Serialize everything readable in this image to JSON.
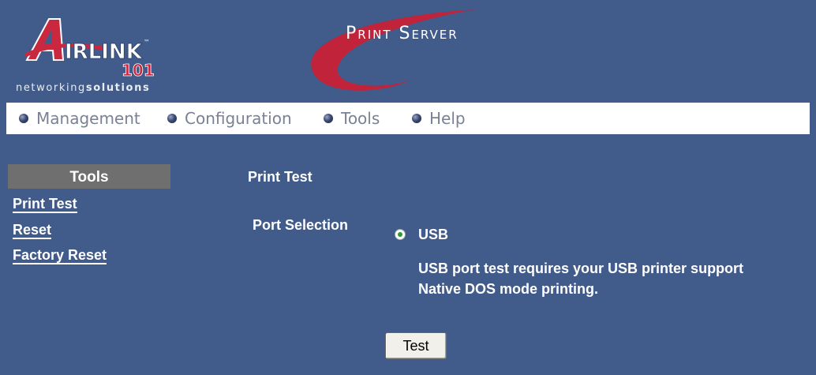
{
  "header": {
    "brand_logo_text": "AIRLINK 101",
    "tagline_light": "networking",
    "tagline_bold": "solutions",
    "product_title": "Print Server"
  },
  "nav": {
    "items": [
      {
        "label": "Management"
      },
      {
        "label": "Configuration"
      },
      {
        "label": "Tools"
      },
      {
        "label": "Help"
      }
    ]
  },
  "sidebar": {
    "title": "Tools",
    "links": [
      {
        "label": "Print Test"
      },
      {
        "label": "Reset"
      },
      {
        "label": "Factory Reset"
      }
    ]
  },
  "main": {
    "section_title": "Print Test",
    "port_selection_label": "Port Selection",
    "port_option": "USB",
    "port_selected": true,
    "note_line1": "USB port test requires your USB printer support",
    "note_line2": "Native DOS mode printing.",
    "test_button_label": "Test"
  },
  "colors": {
    "background": "#415b8b",
    "nav_background": "#ffffff",
    "swoosh": "#c0233a",
    "sidebar_header": "#6f6f6f"
  }
}
